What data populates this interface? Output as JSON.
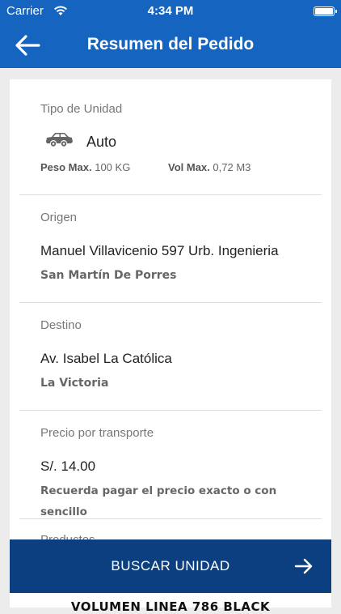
{
  "status_bar": {
    "carrier": "Carrier",
    "time": "4:34 PM"
  },
  "header": {
    "title": "Resumen del Pedido"
  },
  "unit": {
    "label": "Tipo de Unidad",
    "icon": "car-icon",
    "name": "Auto",
    "peso_label": "Peso Max.",
    "peso_value": "100 KG",
    "vol_label": "Vol Max.",
    "vol_value": "0,72 M3"
  },
  "origin": {
    "label": "Origen",
    "address": "Manuel Villavicenio 597 Urb. Ingenieria",
    "district": "San Martín De Porres"
  },
  "destination": {
    "label": "Destino",
    "address": "Av. Isabel La Católica",
    "district": "La Victoria"
  },
  "price": {
    "label": "Precio por transporte",
    "amount": "S/. 14.00",
    "note_line1": "Recuerda pagar el precio exacto o con",
    "note_line2": "sencillo"
  },
  "products": {
    "label": "Productos"
  },
  "footer": {
    "button_label": "BUSCAR UNIDAD",
    "peek_text": "VOLUMEN LINEA 786 BLACK"
  },
  "colors": {
    "primary": "#1565c0",
    "button": "#0b3f80"
  }
}
